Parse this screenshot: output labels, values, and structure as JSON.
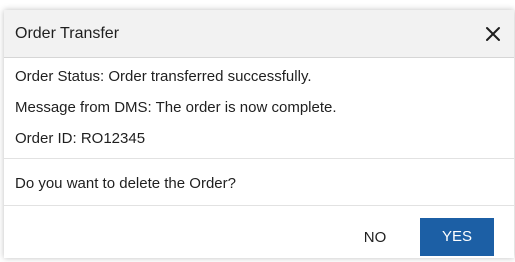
{
  "dialog": {
    "title": "Order Transfer",
    "close_label": "×",
    "status_line": "Order Status: Order transferred successfully.",
    "message_line": "Message from DMS: The order is now complete.",
    "order_id_line": "Order ID: RO12345",
    "question": "Do you want to delete the Order?",
    "no_label": "NO",
    "yes_label": "YES"
  },
  "colors": {
    "header_bg": "#f2f2f2",
    "primary_button": "#1c5fa5",
    "primary_text": "#ffffff",
    "text": "#1f1f1f"
  },
  "icons": {
    "close": "close-icon"
  }
}
